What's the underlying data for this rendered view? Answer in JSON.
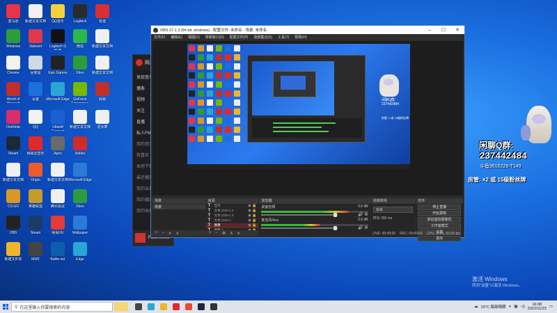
{
  "desktop_icons": [
    {
      "label": "亚马逊",
      "color": "#e8334a"
    },
    {
      "label": "Windows",
      "color": "#2c9c3c"
    },
    {
      "label": "Chrome",
      "color": "#f2f2f2"
    },
    {
      "label": "World of Warcraft",
      "color": "#c0302a"
    },
    {
      "label": "OneNote",
      "color": "#d92e6a"
    },
    {
      "label": "Steam",
      "color": "#1b2838"
    },
    {
      "label": "新建文本文档",
      "color": "#f0f0f0"
    },
    {
      "label": "CS:GO",
      "color": "#d99826"
    },
    {
      "label": "OBS",
      "color": "#222222"
    },
    {
      "label": "新建文件夹",
      "color": "#f0b629"
    },
    {
      "label": "新建文本文档",
      "color": "#f0f0f0"
    },
    {
      "label": "Valorant",
      "color": "#e0384a"
    },
    {
      "label": "回收站",
      "color": "#cfd8e6"
    },
    {
      "label": "设置",
      "color": "#1d6fdb"
    },
    {
      "label": "QQ",
      "color": "#f2f2f2"
    },
    {
      "label": "网易云音乐",
      "color": "#e02a2a"
    },
    {
      "label": "Origin",
      "color": "#ef5a2a"
    },
    {
      "label": "英雄联盟",
      "color": "#c79a2a"
    },
    {
      "label": "Steam",
      "color": "#1b3a68"
    },
    {
      "label": "MW2",
      "color": "#444444"
    },
    {
      "label": "QQ音乐",
      "color": "#f4d13a"
    },
    {
      "label": "Logitech G HUB",
      "color": "#111111"
    },
    {
      "label": "Epic Games",
      "color": "#222222"
    },
    {
      "label": "Microsoft Edge",
      "color": "#2aa6d6"
    },
    {
      "label": "Ubisoft Connect",
      "color": "#1c5fd0"
    },
    {
      "label": "Apex",
      "color": "#6a6a6a"
    },
    {
      "label": "新建文本文档",
      "color": "#f0f0f0"
    },
    {
      "label": "腾讯会议",
      "color": "#f0f0f0"
    },
    {
      "label": "网易UU",
      "color": "#e33a3a"
    },
    {
      "label": "Battle.net",
      "color": "#0c5fae"
    },
    {
      "label": "Logitech",
      "color": "#2a2a2a"
    },
    {
      "label": "微信",
      "color": "#2cb84a"
    },
    {
      "label": "Xbox",
      "color": "#2c9c3c"
    },
    {
      "label": "GeForce Experience",
      "color": "#76b900"
    },
    {
      "label": "新建文本文档",
      "color": "#f0f0f0"
    },
    {
      "label": "Adobe",
      "color": "#d02a2a"
    },
    {
      "label": "Microsoft Edge",
      "color": "#2b7ad8"
    },
    {
      "label": "Xbox",
      "color": "#2c9c3c"
    },
    {
      "label": "Wallpaper",
      "color": "#2a7ad8"
    },
    {
      "label": "Edge",
      "color": "#2aa6d6"
    },
    {
      "label": "有道",
      "color": "#d83030"
    },
    {
      "label": "新建文本文档",
      "color": "#f0f0f0"
    },
    {
      "label": "新建文本文档",
      "color": "#f0f0f0"
    },
    {
      "label": "网易",
      "color": "#c0302a"
    },
    {
      "label": "逆水寒",
      "color": "#f0f0f0"
    }
  ],
  "music_app": {
    "brand": "网易",
    "items": [
      "发现音乐",
      "播客",
      "视频",
      "关注",
      "直播",
      "私人FM",
      "我的音乐",
      "我喜欢",
      "本地下载",
      "最近播放",
      "我的云盘",
      "我的播客",
      "我的收藏"
    ],
    "now_playing": "Fatemeesa"
  },
  "obs": {
    "title": "OBS 27.1.3 (64 bit, windows) - 配置文件: 未命名 - 场景: 未命名",
    "menu": [
      "文件(F)",
      "编辑(E)",
      "视图(V)",
      "停靠窗口(D)",
      "配置文件(P)",
      "场景集合(S)",
      "工具(T)",
      "帮助(H)"
    ],
    "preview_qq": [
      "闲聊Q群:",
      "237442484"
    ],
    "preview_promo": "房管: 2 或 15级粉丝牌",
    "docks": {
      "scenes": {
        "title": "场景",
        "items": [
          "场景"
        ]
      },
      "sources": {
        "title": "来源",
        "items": [
          "显示",
          "文本 (GDI+) 2",
          "文本 (GDI+) 3",
          "文本 (GDI+)",
          "图像",
          "图像 2"
        ],
        "selected": 4
      },
      "mixer": {
        "title": "混音器",
        "channels": [
          {
            "name": "桌面音频",
            "db": "0.0 dB",
            "level": 0.82
          },
          {
            "name": "麦克风/Aux",
            "db": "0.0 dB",
            "level": 0.55
          }
        ]
      },
      "transitions": {
        "title": "场景转场",
        "value": "淡出",
        "duration_label": "时长",
        "duration": "300 ms"
      },
      "controls": {
        "title": "控件",
        "buttons": [
          "停止直播",
          "开始录制",
          "启动虚拟摄像机",
          "工作室模式",
          "设置",
          "退出"
        ]
      }
    },
    "dock_toolbar_scenes": [
      "+",
      "−",
      "∧",
      "∨"
    ],
    "dock_toolbar_sources": [
      "+",
      "−",
      "⚙",
      "∧",
      "∨"
    ],
    "status": [
      "LIVE: 00:00:00",
      "REC: 00:00:00",
      "CPU: 3.4%, 60.00 fps"
    ]
  },
  "overlay": {
    "qq_label": "闲聊Q群:",
    "qq_number": "237442484",
    "douyu_id": "斗鱼9616229-T149",
    "promo": "房管: ×2 或 15级粉丝牌"
  },
  "activate": {
    "line1": "激活 Windows",
    "line2": "转到\"设置\"以激活 Windows。"
  },
  "taskbar": {
    "search_placeholder": "在这里输入你要搜索的内容",
    "apps": [
      {
        "name": "task-view",
        "color": "#444444"
      },
      {
        "name": "edge",
        "color": "#2aa6d6"
      },
      {
        "name": "file-explorer",
        "color": "#f0b629"
      },
      {
        "name": "netease-music",
        "color": "#e02a2a"
      },
      {
        "name": "store",
        "color": "#e84b3a"
      },
      {
        "name": "steam",
        "color": "#1b2838"
      },
      {
        "name": "obs",
        "color": "#333333"
      }
    ],
    "weather": "15°C 局部晴朗",
    "time": "16:08",
    "date": "2022/11/23"
  }
}
